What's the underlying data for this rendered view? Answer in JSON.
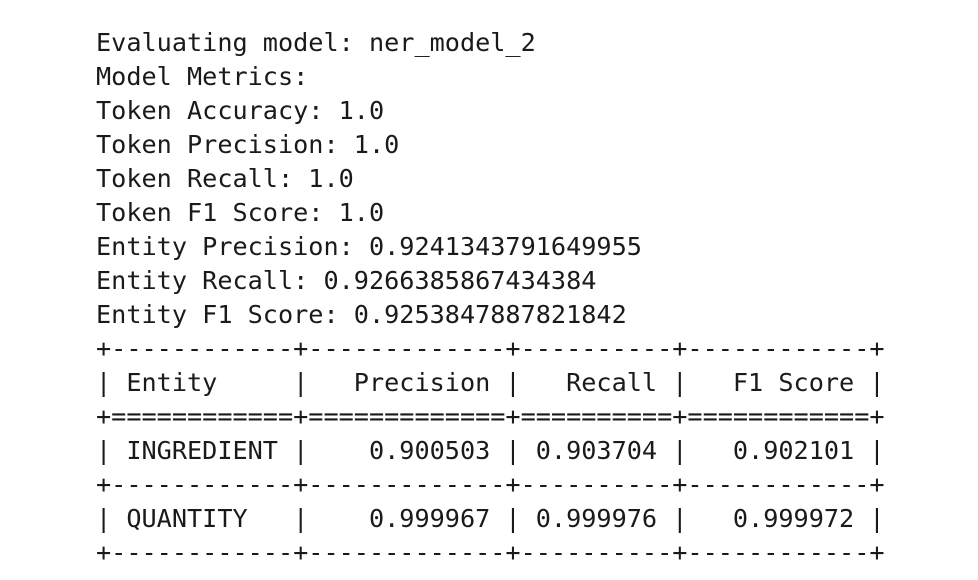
{
  "output": {
    "evaluating": "Evaluating model: ner_model_2",
    "metrics_header": "Model Metrics:",
    "metrics": [
      "Token Accuracy: 1.0",
      "Token Precision: 1.0",
      "Token Recall: 1.0",
      "Token F1 Score: 1.0",
      "Entity Precision: 0.9241343791649955",
      "Entity Recall: 0.9266385867434384",
      "Entity F1 Score: 0.9253847887821842"
    ]
  },
  "table": {
    "border_top": "+------------+-------------+----------+------------+",
    "header": "| Entity     |   Precision |   Recall |   F1 Score |",
    "header_separator": "+============+=============+==========+============+",
    "rows": [
      "| INGREDIENT |    0.900503 | 0.903704 |   0.902101 |",
      "| QUANTITY   |    0.999967 | 0.999976 |   0.999972 |"
    ],
    "row_separator": "+------------+-------------+----------+------------+",
    "border_bottom": "+------------+-------------+----------+------------+"
  }
}
